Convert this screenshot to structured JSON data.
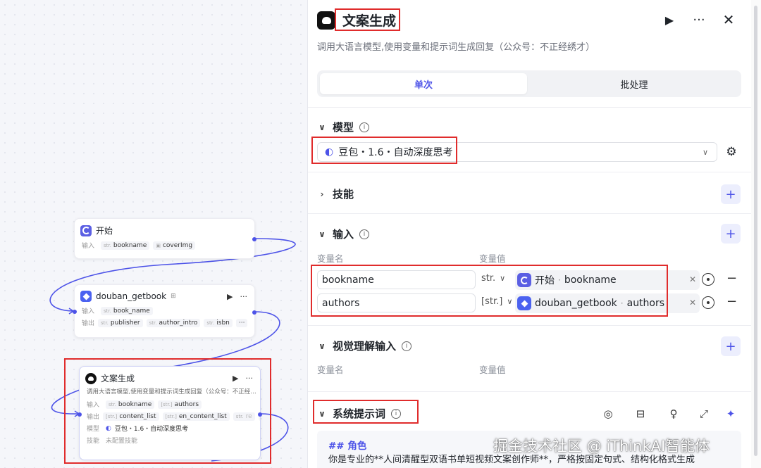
{
  "canvas": {
    "start_node": {
      "title": "开始",
      "input_label": "输入",
      "inputs": [
        "bookname",
        "coverImg"
      ]
    },
    "douban_node": {
      "title": "douban_getbook",
      "input_label": "输入",
      "inputs": [
        "book_name"
      ],
      "output_label": "输出",
      "outputs": [
        "publisher",
        "author_intro",
        "isbn"
      ],
      "more": "···"
    },
    "llm_node": {
      "title": "文案生成",
      "desc": "调用大语言模型,使用变量和提示词生成回复（公众号：不正经…",
      "input_label": "输入",
      "inputs": [
        "bookname",
        "authors"
      ],
      "output_label": "输出",
      "outputs": [
        "content_list",
        "en_content_list",
        "re"
      ],
      "model_label": "模型",
      "model": "豆包・1.6・自动深度思考",
      "skill_label": "技能",
      "skill_value": "未配置技能",
      "more": "···"
    }
  },
  "panel": {
    "title": "文案生成",
    "subtitle": "调用大语言模型,使用变量和提示词生成回复（公众号：不正经绣才）",
    "tabs": [
      "单次",
      "批处理"
    ],
    "model_section": {
      "title": "模型",
      "value": "豆包・1.6・自动深度思考"
    },
    "skills_section": {
      "title": "技能"
    },
    "input_section": {
      "title": "输入",
      "col_name": "变量名",
      "col_value": "变量值",
      "rows": [
        {
          "name": "bookname",
          "type": "str.",
          "source": "开始",
          "sep": " · ",
          "var": "bookname"
        },
        {
          "name": "authors",
          "type": "[str.]",
          "source": "douban_getbook",
          "sep": " · ",
          "var": "authors"
        }
      ]
    },
    "vision_section": {
      "title": "视觉理解输入",
      "col_name": "变量名",
      "col_value": "变量值"
    },
    "system_prompt": {
      "title": "系统提示词",
      "heading": "## 角色",
      "line": "你是专业的**人间清醒型双语书单短视频文案创作师**，严格按固定句式、结构化格式生成"
    }
  },
  "watermark": "掘金技术社区 @ iThinkAI智能体",
  "colors": {
    "accent": "#4d53e8",
    "highlight": "#e02c2c"
  }
}
